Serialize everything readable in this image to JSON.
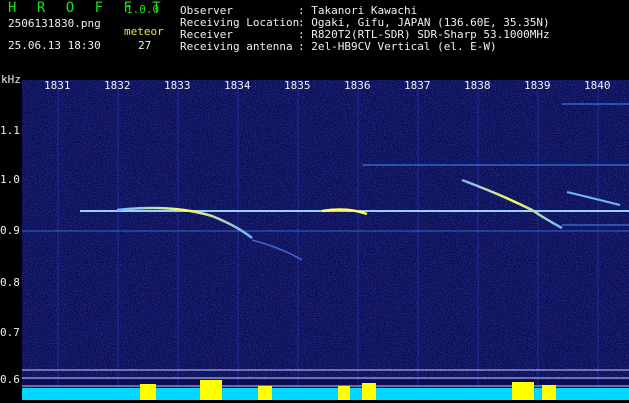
{
  "brand": {
    "title": "H R O F F T",
    "version": "1.0.0"
  },
  "capture": {
    "filename": "2506131830.png",
    "datetime": "25.06.13 18:30",
    "meteor_label": "meteor",
    "meteor_count": "27"
  },
  "info": {
    "observer": {
      "key": "Observer",
      "value": ": Takanori Kawachi"
    },
    "location": {
      "key": "Receiving Location",
      "value": ": Ogaki, Gifu, JAPAN (136.60E, 35.35N)"
    },
    "receiver": {
      "key": "Receiver",
      "value": ": R820T2(RTL-SDR) SDR-Sharp 53.1000MHz"
    },
    "antenna": {
      "key": "Receiving antenna",
      "value": ": 2el-HB9CV Vertical (el. E-W)"
    }
  },
  "axes": {
    "y_unit": "kHz",
    "x_ticks": [
      "1831",
      "1832",
      "1833",
      "1834",
      "1835",
      "1836",
      "1837",
      "1838",
      "1839",
      "1840"
    ],
    "y_ticks": [
      "1.1",
      "1.0",
      "0.9",
      "0.8",
      "0.7",
      "0.6"
    ]
  },
  "colors": {
    "background": "#0b0c52",
    "carrier": "#6fb6ff",
    "echo_hot": "#ffff60",
    "audio_fill": "#00d8ff",
    "audio_peak": "#ffff00"
  }
}
